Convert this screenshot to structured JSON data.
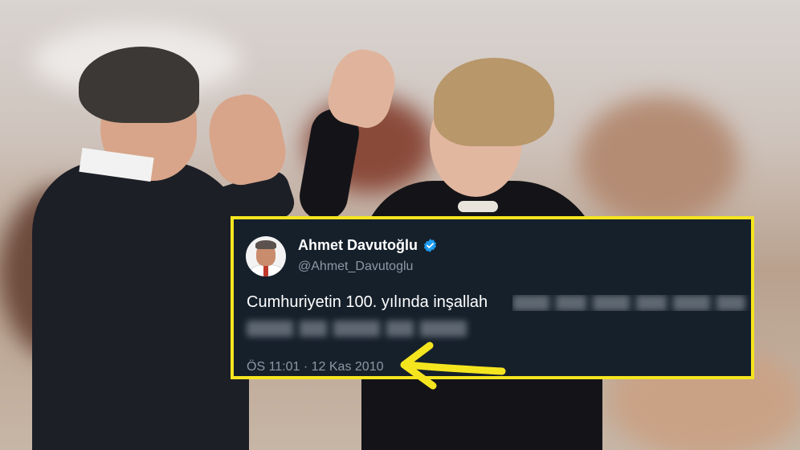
{
  "tweet": {
    "display_name": "Ahmet Davutoğlu",
    "handle": "@Ahmet_Davutoglu",
    "text_visible": "Cumhuriyetin 100. yılında inşallah",
    "timestamp": "ÖS 11:01 · 12 Kas 2010",
    "verified": true
  },
  "colors": {
    "highlight_border": "#f5e51f",
    "arrow": "#f5e51f",
    "card_background": "#16202b",
    "verified_badge": "#1d9bf0"
  },
  "icons": {
    "verified": "verified-badge-icon",
    "arrow": "arrow-left-icon"
  }
}
